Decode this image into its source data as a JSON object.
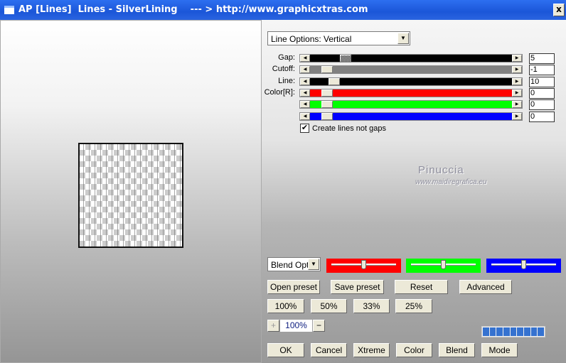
{
  "window": {
    "title": "AP [Lines]  Lines - SilverLining    --- > http://www.graphicxtras.com",
    "close": "x"
  },
  "options": {
    "line_options": "Line Options: Vertical",
    "sliders": [
      {
        "label": "Gap:",
        "value": "5",
        "color": "#000000"
      },
      {
        "label": "Cutoff:",
        "value": "-1",
        "color": "#808080"
      },
      {
        "label": "Line:",
        "value": "10",
        "color": "#000000"
      },
      {
        "label": "Color[R]:",
        "value": "0",
        "color": "#ff0000"
      },
      {
        "label": "",
        "value": "0",
        "color": "#00ff00"
      },
      {
        "label": "",
        "value": "0",
        "color": "#0000ff"
      }
    ],
    "create_lines_label": "Create lines not gaps",
    "create_lines_checked": true
  },
  "watermark": {
    "name": "Pinuccia",
    "url": "www.maidiregrafica.eu"
  },
  "blend": {
    "select": "Blend Optio",
    "color_sliders": [
      {
        "color": "#ff0000",
        "level": 0.5
      },
      {
        "color": "#00ff00",
        "level": 0.5
      },
      {
        "color": "#0000ff",
        "level": 0.5
      }
    ]
  },
  "buttons": {
    "open_preset": "Open preset",
    "save_preset": "Save preset",
    "reset": "Reset",
    "advanced": "Advanced",
    "z100": "100%",
    "z50": "50%",
    "z33": "33%",
    "z25": "25%",
    "ok": "OK",
    "cancel": "Cancel",
    "xtreme": "Xtreme",
    "color": "Color",
    "blend": "Blend",
    "mode": "Mode"
  },
  "zoom": {
    "plus": "+",
    "value": "100%",
    "minus": "−"
  },
  "progress": {
    "blocks": 9,
    "color": "#3572d0"
  }
}
